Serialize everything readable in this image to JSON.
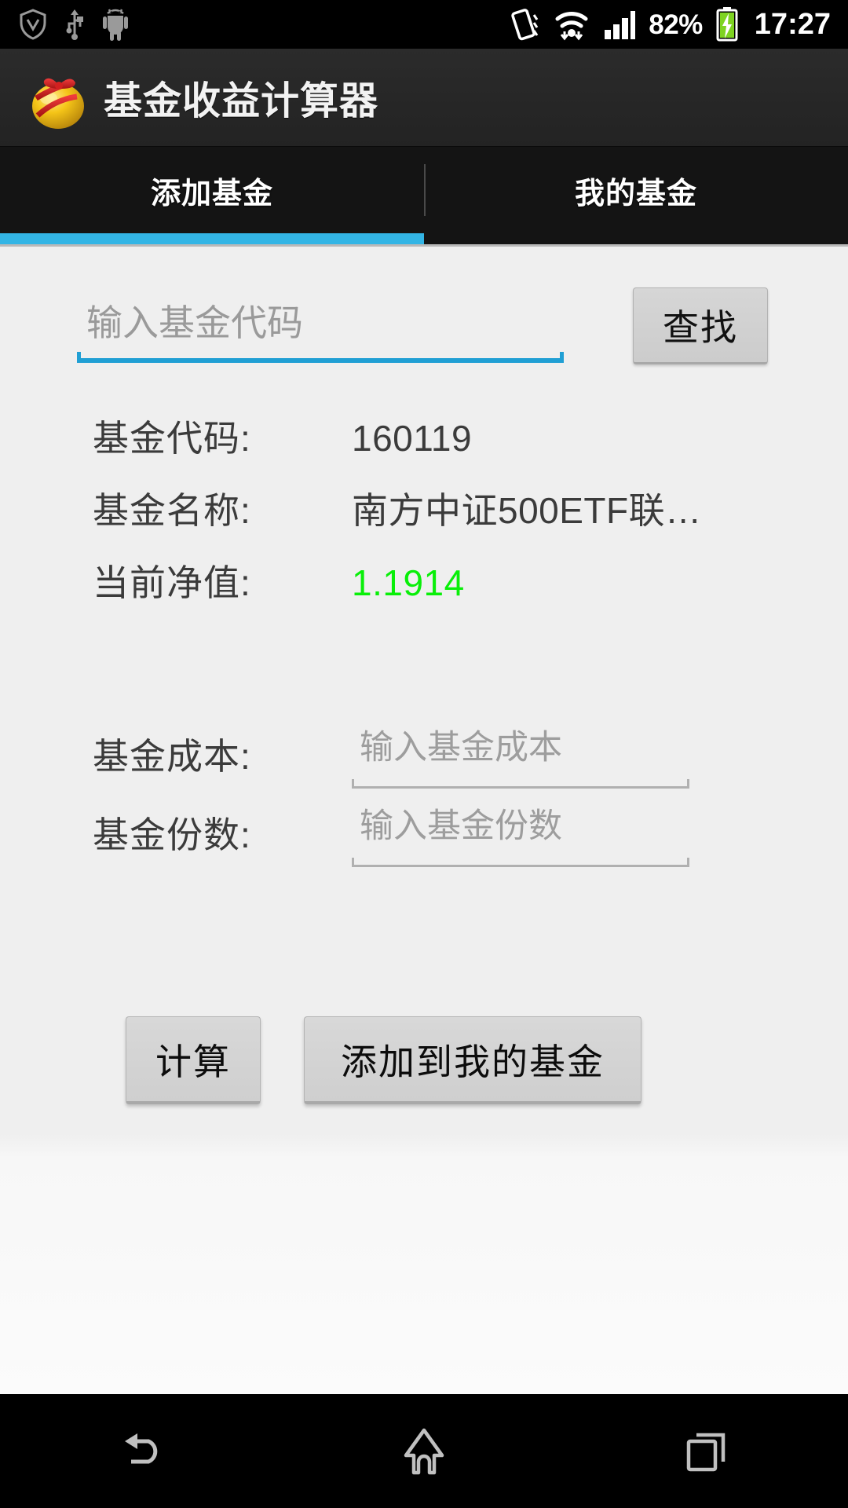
{
  "status_bar": {
    "icons_left": [
      "shield-download-icon",
      "usb-icon",
      "android-robot-icon"
    ],
    "icons_right": [
      "vibrate-icon",
      "wifi-icon",
      "signal-bars-icon",
      "battery-charging-icon"
    ],
    "battery_percent": "82%",
    "clock": "17:27"
  },
  "action_bar": {
    "icon": "golden-egg-icon",
    "title": "基金收益计算器"
  },
  "tabs": {
    "items": [
      {
        "label": "添加基金",
        "selected": true
      },
      {
        "label": "我的基金",
        "selected": false
      }
    ],
    "indicator_color": "#33b5e5"
  },
  "search": {
    "placeholder": "输入基金代码",
    "value": "",
    "button_label": "查找",
    "underline_color": "#209fd4"
  },
  "fund_info": [
    {
      "label": "基金代码:",
      "value": "160119",
      "value_color": "#3b3b3b"
    },
    {
      "label": "基金名称:",
      "value": "南方中证500ETF联…",
      "value_color": "#3b3b3b"
    },
    {
      "label": "当前净值:",
      "value": "1.1914",
      "value_color": "#09ef09"
    }
  ],
  "fund_inputs": [
    {
      "label": "基金成本:",
      "placeholder": "输入基金成本",
      "value": ""
    },
    {
      "label": "基金份数:",
      "placeholder": "输入基金份数",
      "value": ""
    }
  ],
  "actions": {
    "calculate_label": "计算",
    "add_label": "添加到我的基金"
  },
  "nav_bar": {
    "back": "back-icon",
    "home": "home-icon",
    "recents": "recents-icon"
  }
}
